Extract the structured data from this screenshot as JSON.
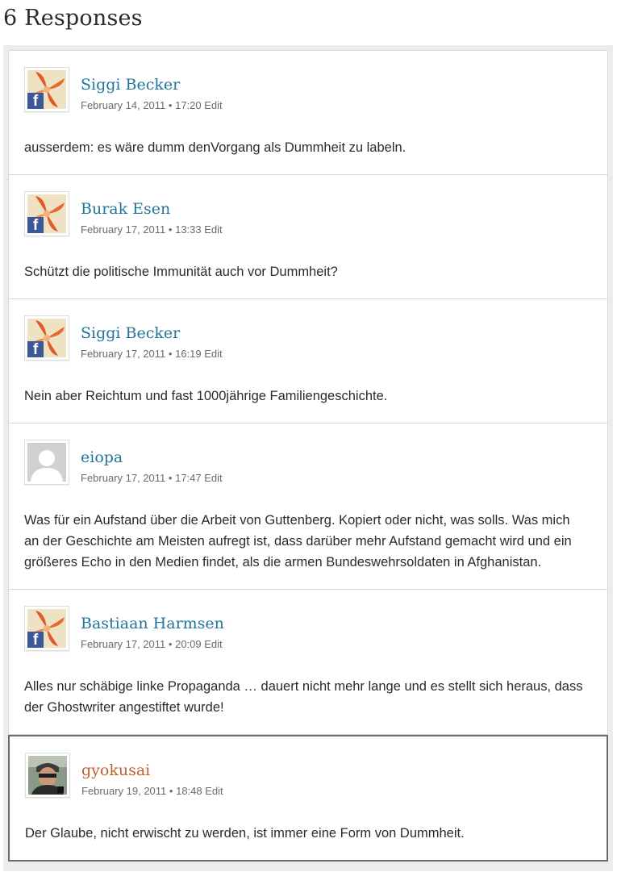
{
  "title": "6 Responses",
  "comments": [
    {
      "author": "Siggi Becker",
      "date": "February 14, 2011",
      "time": "17:20",
      "edit": "Edit",
      "avatar": "facebook-avatar",
      "text": "ausserdem: es wäre dumm denVorgang als Dummheit zu labeln."
    },
    {
      "author": "Burak Esen",
      "date": "February 17, 2011",
      "time": "13:33",
      "edit": "Edit",
      "avatar": "facebook-avatar",
      "text": "Schützt die politische Immunität auch vor Dummheit?"
    },
    {
      "author": "Siggi Becker",
      "date": "February 17, 2011",
      "time": "16:19",
      "edit": "Edit",
      "avatar": "facebook-avatar",
      "text": "Nein aber Reichtum und fast 1000jährige Familiengeschichte."
    },
    {
      "author": "eiopa",
      "date": "February 17, 2011",
      "time": "17:47",
      "edit": "Edit",
      "avatar": "default-user-avatar",
      "text": "Was für ein Aufstand über die Arbeit von Guttenberg. Kopiert oder nicht, was solls. Was mich an der Geschichte am Meisten aufregt ist, dass darüber mehr Aufstand gemacht wird und ein größeres Echo in den Medien findet, als die armen Bundeswehrsoldaten in Afghanistan."
    },
    {
      "author": "Bastiaan Harmsen",
      "date": "February 17, 2011",
      "time": "20:09",
      "edit": "Edit",
      "avatar": "facebook-avatar",
      "text": "Alles nur schäbige linke Propaganda … dauert nicht mehr lange und es stellt sich heraus, dass der Ghostwriter angestiftet wurde!"
    },
    {
      "author": "gyokusai",
      "date": "February 19, 2011",
      "time": "18:48",
      "edit": "Edit",
      "avatar": "photo-avatar",
      "text": "Der Glaube, nicht erwischt zu werden, ist immer eine Form von Dummheit."
    }
  ],
  "colors": {
    "link": "#21759b",
    "author_highlight": "#c0612b",
    "facebook_blue": "#3b5998",
    "highlight_border": "#6d6d6d"
  },
  "separator": "•"
}
